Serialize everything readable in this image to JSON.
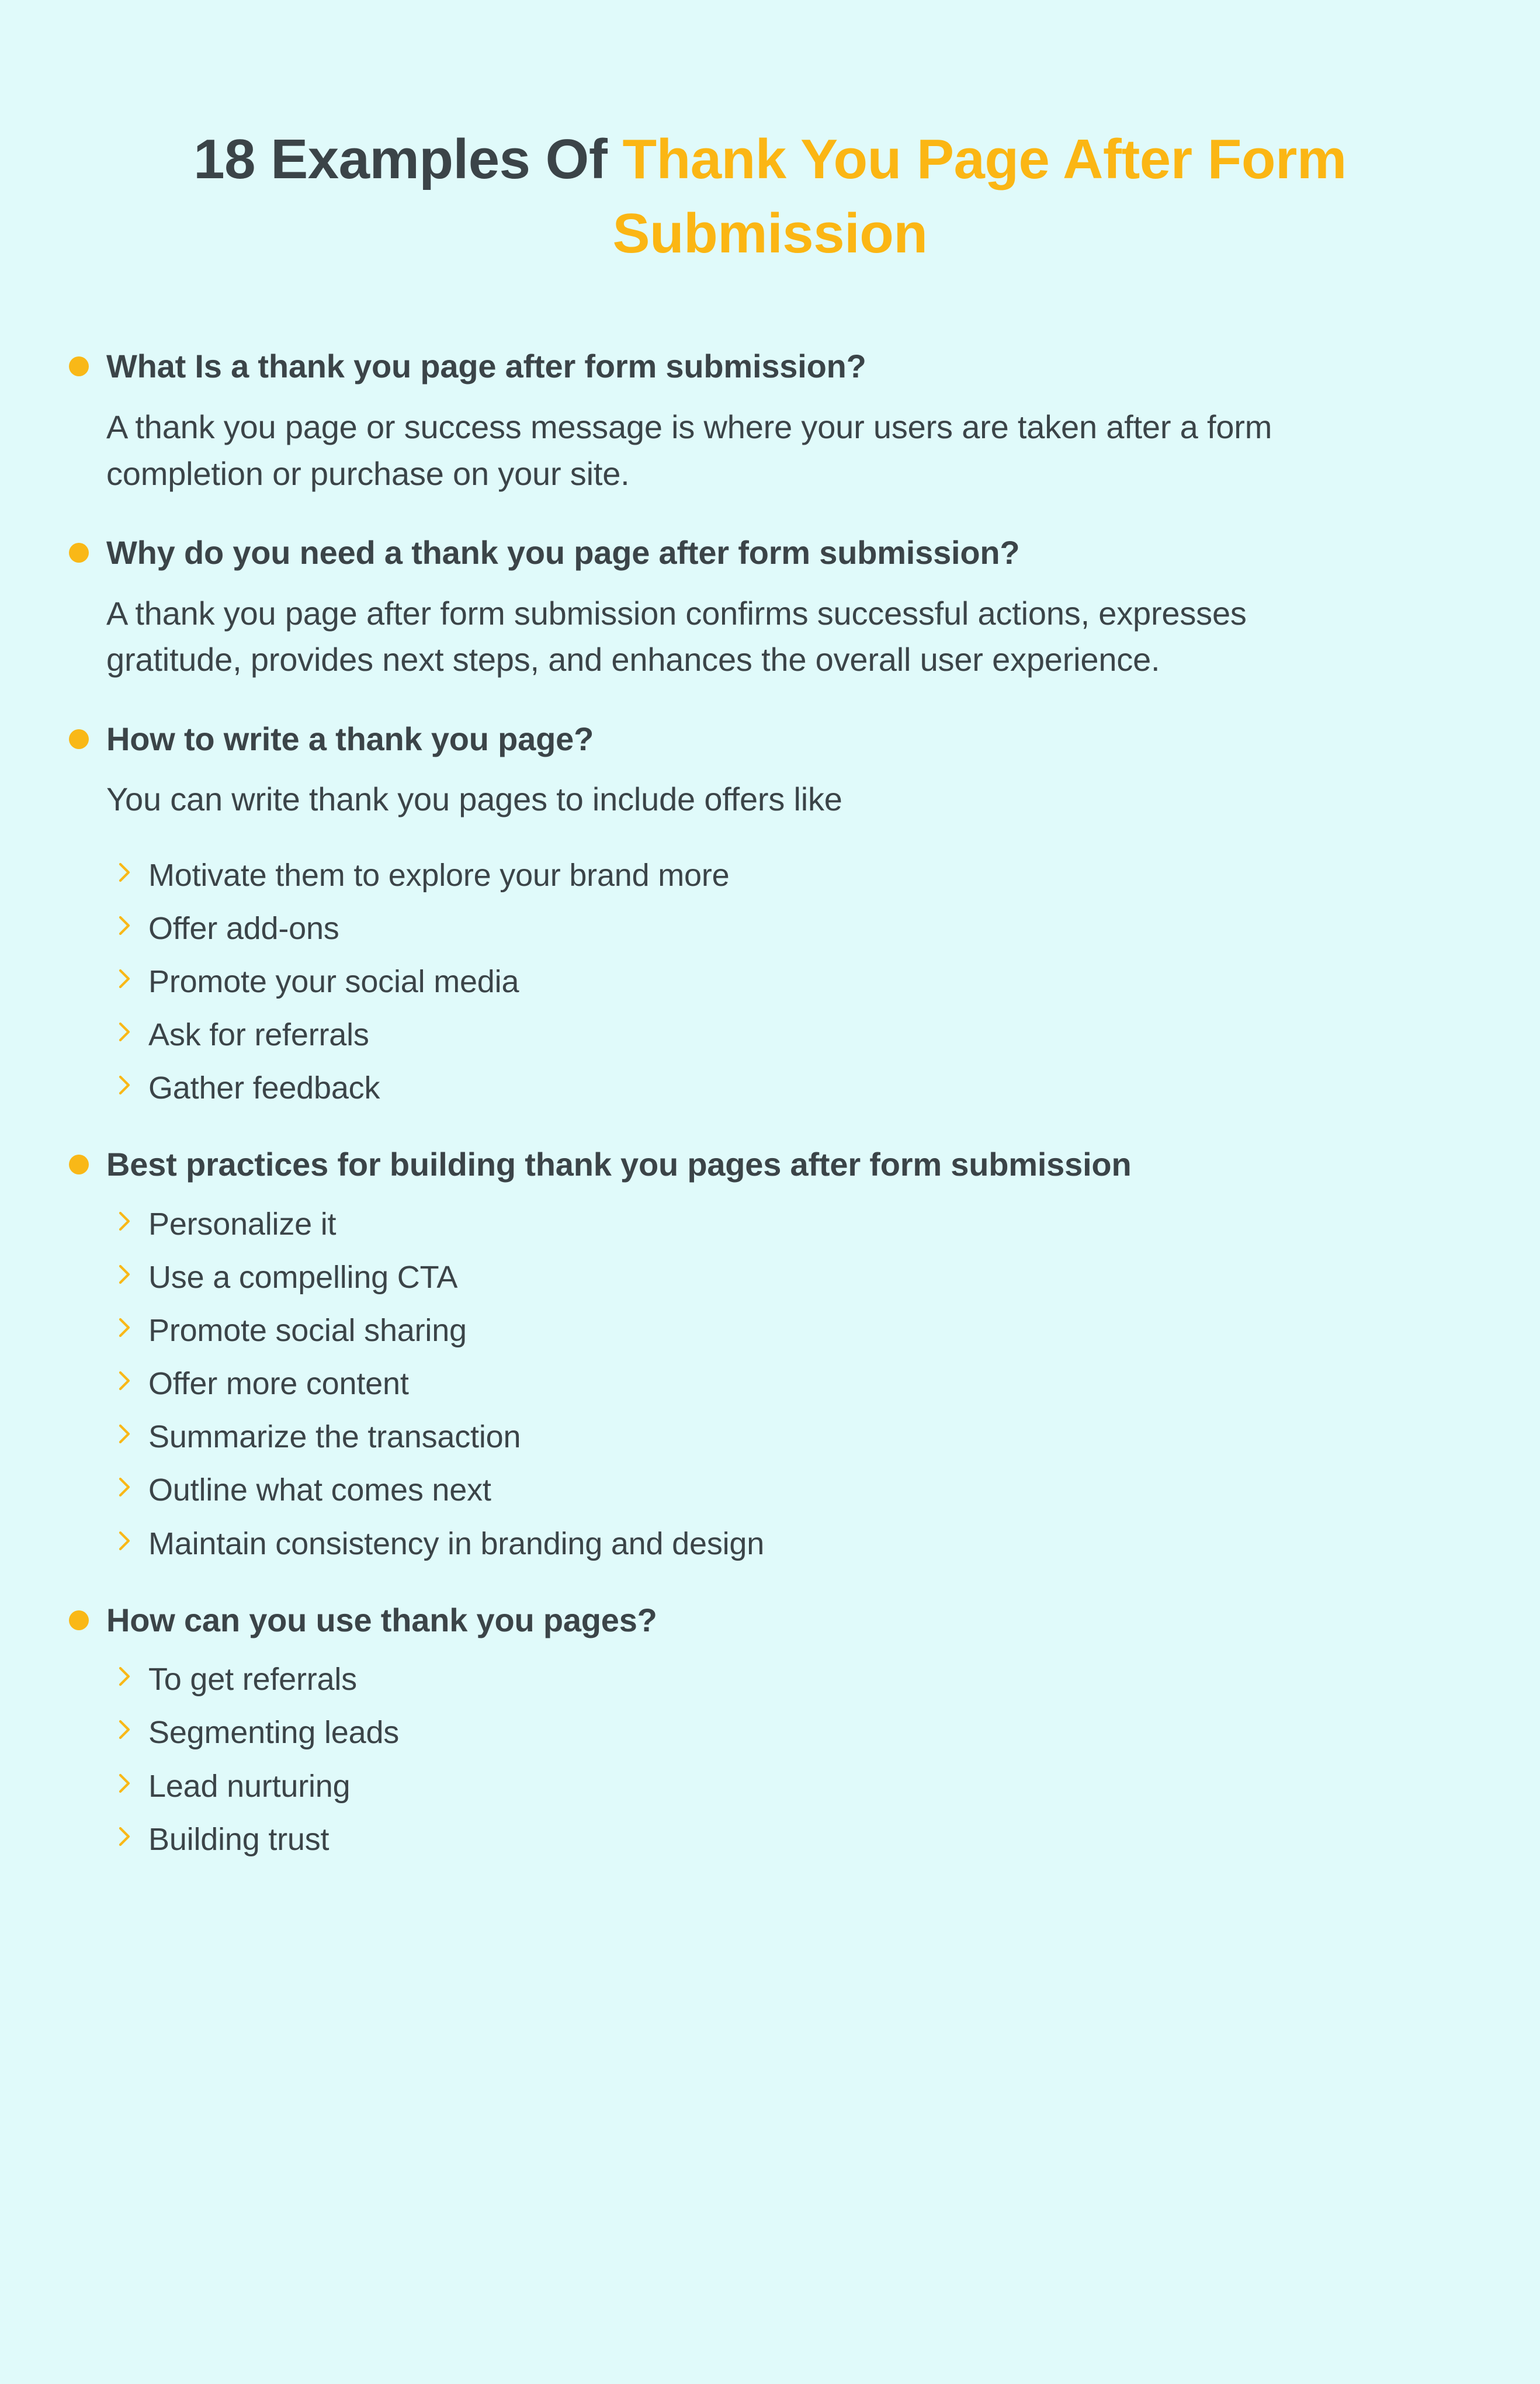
{
  "title": {
    "prefix": "18 Examples Of ",
    "accent": "Thank You Page After Form Submission",
    "accent_color": "#FBB614",
    "text_color": "#3B4448"
  },
  "theme": {
    "background": "#E0FAFA",
    "bullet_color": "#F9B817",
    "chevron_color": "#F9B817",
    "body_text": "#3B4448"
  },
  "sections": [
    {
      "heading": "What Is a thank you page after form submission?",
      "paragraph": "A thank you page or success message is where your users are taken after a form completion or purchase on your site.",
      "items": []
    },
    {
      "heading": "Why do you need a thank you page after form submission?",
      "paragraph": "A thank you page after form submission confirms successful actions, expresses gratitude, provides next steps, and enhances the overall user experience.",
      "items": []
    },
    {
      "heading": "How to write a thank you page?",
      "paragraph": "You can write thank you pages to include offers like",
      "items": [
        "Motivate them to explore your brand more",
        "Offer add-ons",
        "Promote your social media",
        "Ask for referrals",
        "Gather feedback"
      ]
    },
    {
      "heading": "Best practices for building thank you pages after form submission",
      "paragraph": "",
      "items": [
        "Personalize it",
        "Use a compelling CTA",
        "Promote social sharing",
        "Offer more content",
        "Summarize the transaction",
        "Outline what comes next",
        "Maintain consistency in branding and design"
      ]
    },
    {
      "heading": "How can you use thank you pages?",
      "paragraph": "",
      "items": [
        "To get referrals",
        "Segmenting leads",
        "Lead nurturing",
        "Building trust"
      ]
    }
  ]
}
